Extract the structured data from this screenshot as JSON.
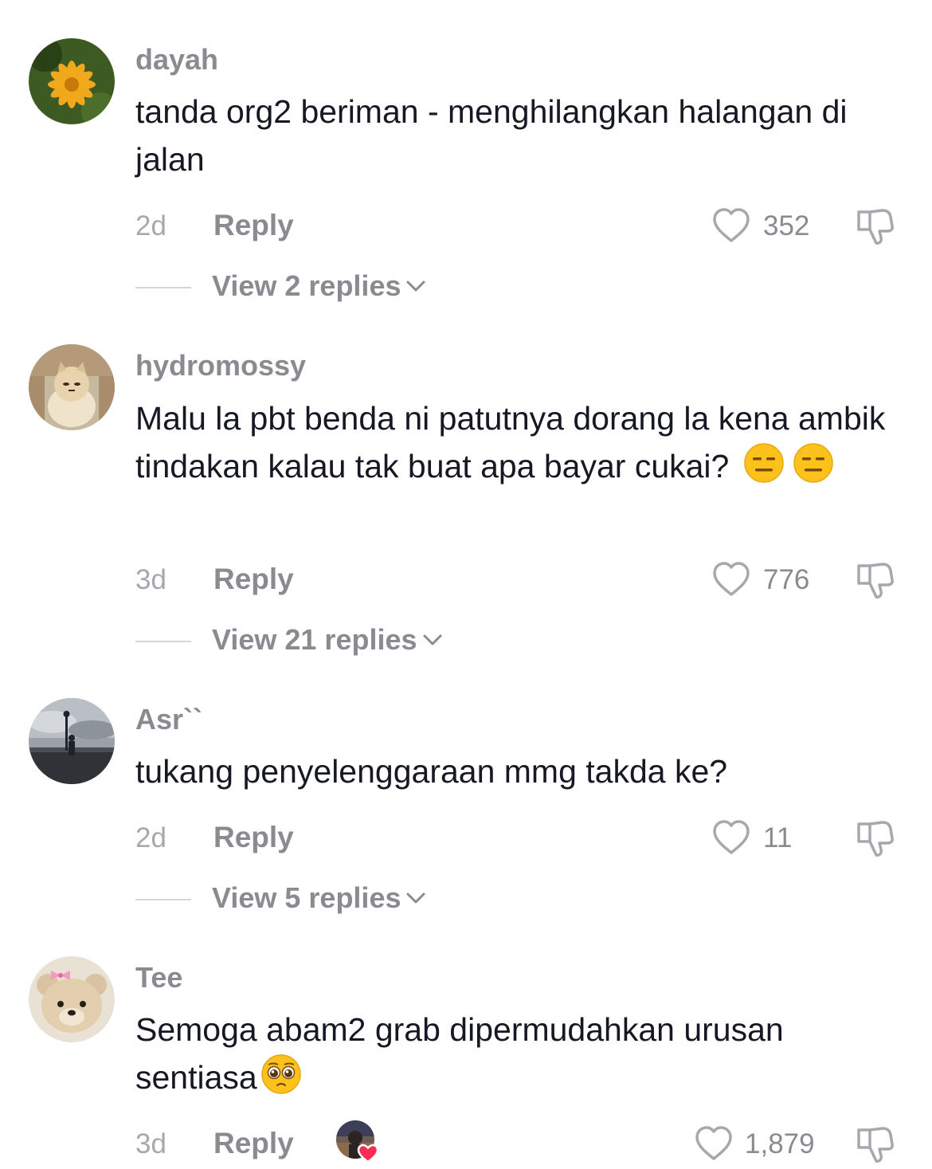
{
  "comments": [
    {
      "username": "dayah",
      "text": "tanda org2 beriman - menghilangkan halangan di jalan",
      "age": "2d",
      "reply_label": "Reply",
      "likes": "352",
      "view_replies": "View 2 replies"
    },
    {
      "username": "hydromossy",
      "text": "Malu la pbt benda ni patutnya dorang la kena ambik tindakan kalau tak buat apa bayar cukai?",
      "emoji": [
        "expressionless-face",
        "expressionless-face"
      ],
      "age": "3d",
      "reply_label": "Reply",
      "likes": "776",
      "view_replies": "View 21 replies"
    },
    {
      "username": "Asr``",
      "text": "tukang penyelenggaraan mmg takda ke?",
      "age": "2d",
      "reply_label": "Reply",
      "likes": "11",
      "view_replies": "View 5 replies"
    },
    {
      "username": "Tee",
      "text": "Semoga abam2 grab dipermudahkan urusan sentiasa",
      "emoji": [
        "pleading-face"
      ],
      "age": "3d",
      "reply_label": "Reply",
      "likes": "1,879"
    }
  ],
  "colors": {
    "username": "#8a8b91",
    "text": "#161823",
    "meta": "#a7a8ad",
    "liked_heart_badge": "#fe2c55"
  }
}
